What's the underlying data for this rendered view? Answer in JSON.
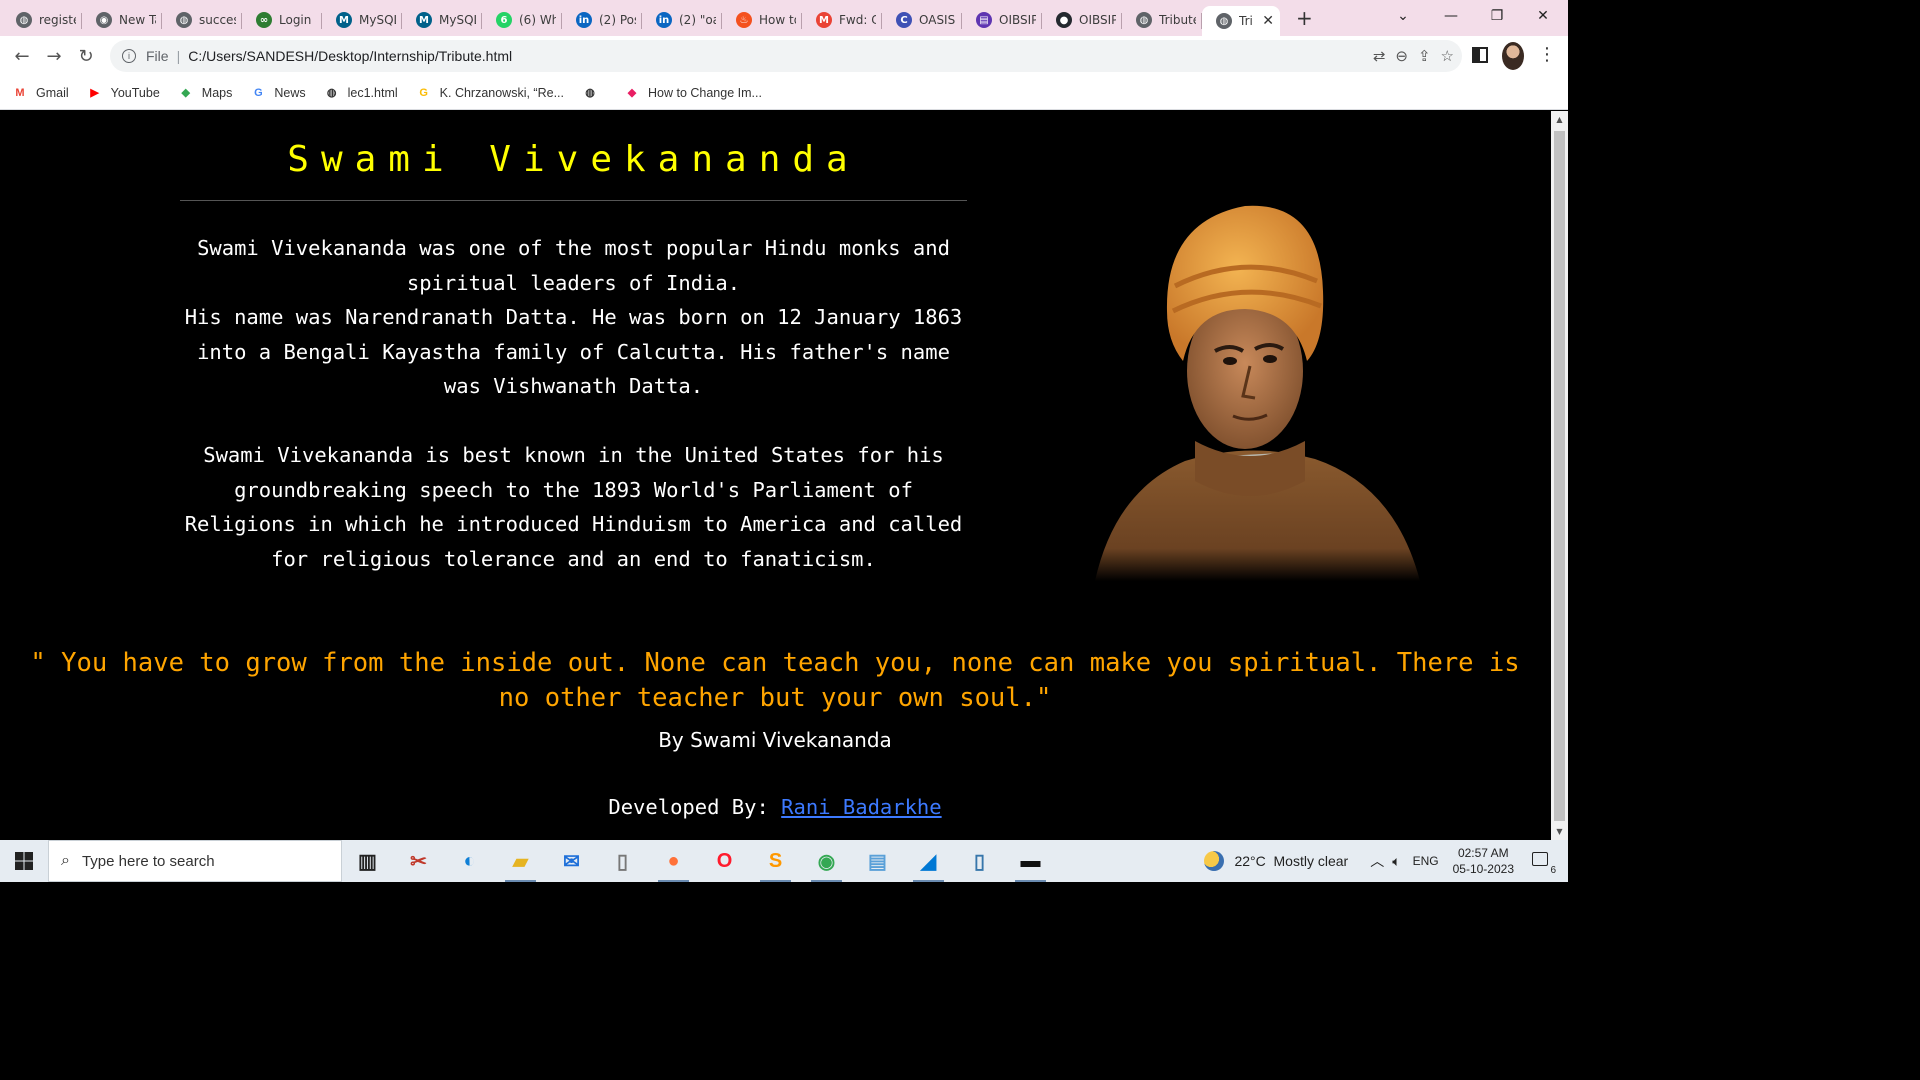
{
  "browser": {
    "tabs": [
      {
        "title": "registe",
        "icon": "globe-icon",
        "color": "#5f6368"
      },
      {
        "title": "New Ta",
        "icon": "chrome-icon",
        "color": "#5f6368"
      },
      {
        "title": "success",
        "icon": "globe-icon",
        "color": "#5f6368"
      },
      {
        "title": "Login a",
        "icon": "glasses-icon",
        "color": "#2e7d32"
      },
      {
        "title": "MySQL",
        "icon": "mysql-icon",
        "color": "#00618a"
      },
      {
        "title": "MySQL",
        "icon": "mysql-icon",
        "color": "#00618a"
      },
      {
        "title": "(6) Wha",
        "icon": "whatsapp-icon",
        "color": "#25d366"
      },
      {
        "title": "(2) Post",
        "icon": "linkedin-icon",
        "color": "#0a66c2"
      },
      {
        "title": "(2) \"oa",
        "icon": "linkedin-icon",
        "color": "#0a66c2"
      },
      {
        "title": "How to",
        "icon": "fire-icon",
        "color": "#f4511e"
      },
      {
        "title": "Fwd: C",
        "icon": "gmail-icon",
        "color": "#ea4335"
      },
      {
        "title": "OASIS",
        "icon": "oasis-icon",
        "color": "#3f51b5"
      },
      {
        "title": "OIBSIP",
        "icon": "oibsip-icon",
        "color": "#5e35b1"
      },
      {
        "title": "OIBSIP,",
        "icon": "github-icon",
        "color": "#24292f"
      },
      {
        "title": "Tribute",
        "icon": "globe-icon",
        "color": "#5f6368"
      },
      {
        "title": "Tri",
        "icon": "globe-icon",
        "color": "#5f6368",
        "active": true
      }
    ],
    "new_tab_label": "+",
    "address": {
      "scheme_label": "File",
      "url": "C:/Users/SANDESH/Desktop/Internship/Tribute.html"
    },
    "bookmarks": [
      {
        "label": "Gmail",
        "icon": "gmail-icon"
      },
      {
        "label": "YouTube",
        "icon": "youtube-icon"
      },
      {
        "label": "Maps",
        "icon": "maps-icon"
      },
      {
        "label": "News",
        "icon": "news-icon"
      },
      {
        "label": "lec1.html",
        "icon": "globe-icon"
      },
      {
        "label": "K. Chrzanowski, “Re...",
        "icon": "google-icon"
      },
      {
        "label": "",
        "icon": "globe-icon"
      },
      {
        "label": "How to Change Im...",
        "icon": "app-icon"
      }
    ]
  },
  "page": {
    "heading": "Swami Vivekananda",
    "intro_paragraph_1": "Swami Vivekananda was one of the most popular Hindu monks and spiritual leaders of India.",
    "intro_paragraph_2": "His name was Narendranath Datta. He was born on 12 January 1863 into a Bengali Kayastha family of Calcutta. His father's name was Vishwanath Datta.",
    "intro_paragraph_3": "Swami Vivekananda is best known in the United States for his groundbreaking speech to the 1893 World's Parliament of Religions in which he introduced Hinduism to America and called for religious tolerance and an end to fanaticism.",
    "quote": "\" You have to grow from the inside out. None can teach you, none can make you spiritual. There is no other teacher but your own soul.\"",
    "quote_author": "By Swami Vivekananda",
    "footer_label": "Developed By:",
    "footer_link": "Rani Badarkhe",
    "colors": {
      "heading": "#ffff00",
      "quote": "#ffa500",
      "link": "#3d7aff",
      "background": "#000000"
    }
  },
  "taskbar": {
    "search_placeholder": "Type here to search",
    "apps": [
      "task-view-icon",
      "snipping-tool-icon",
      "edge-icon",
      "file-explorer-icon",
      "mail-icon",
      "file-icon",
      "firefox-icon",
      "opera-icon",
      "sublime-icon",
      "chrome-icon",
      "notepad-icon",
      "vscode-icon",
      "python-file-icon",
      "terminal-icon"
    ],
    "weather": "22°C  Mostly clear",
    "language": "ENG",
    "time": "02:57 AM",
    "date": "05-10-2023",
    "notifications": "6"
  }
}
